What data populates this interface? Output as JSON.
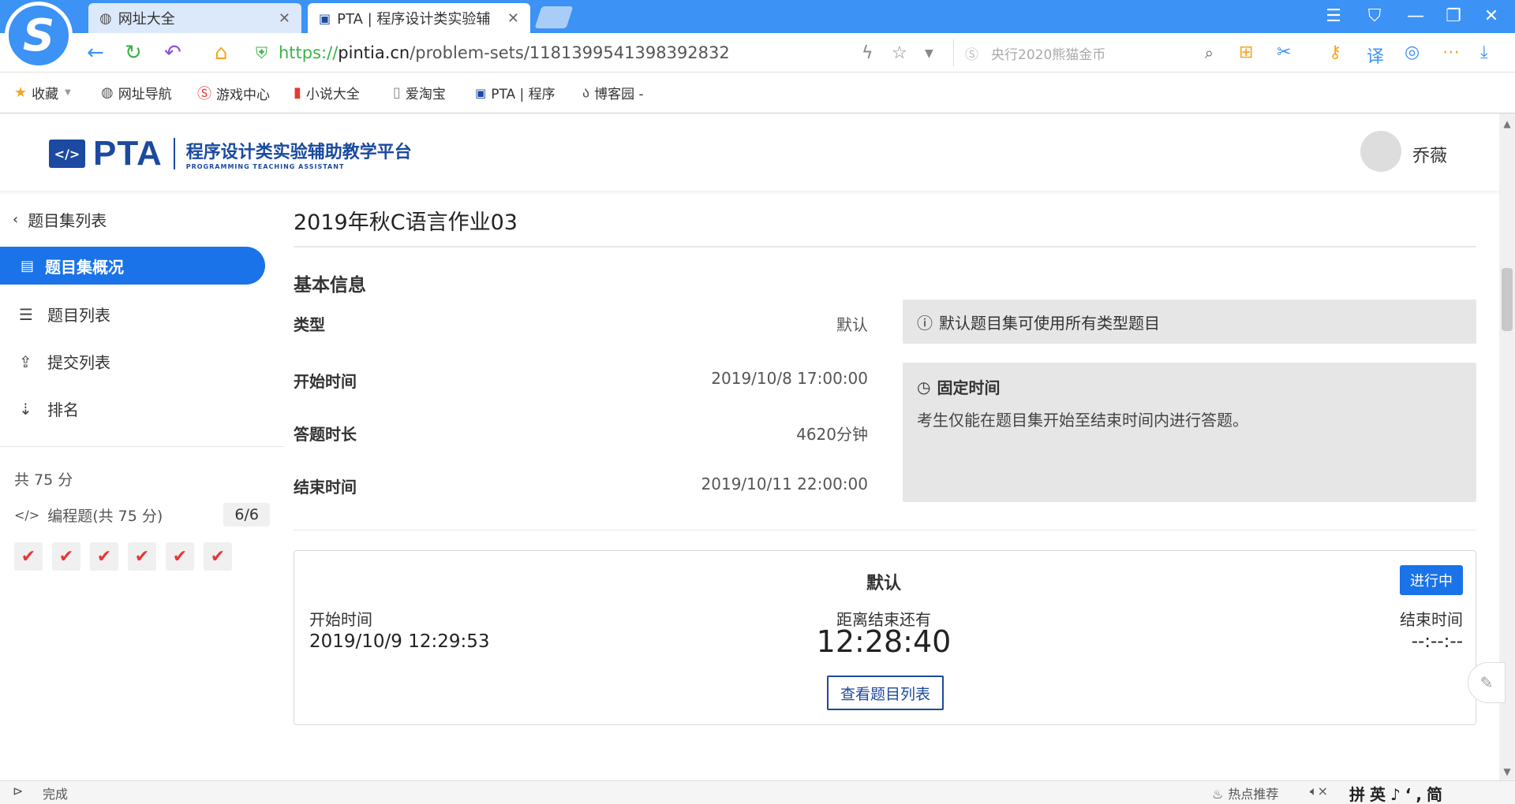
{
  "browser": {
    "tabs": [
      {
        "label": "网址大全",
        "active": false
      },
      {
        "label": "PTA | 程序设计类实验辅",
        "active": true
      }
    ],
    "url_scheme": "https://",
    "url_host": "pintia.cn",
    "url_path": "/problem-sets/1181399541398392832",
    "search_placeholder": "央行2020熊猫金币",
    "bookmarks": [
      {
        "label": "收藏",
        "icon": "star-icon"
      },
      {
        "label": "网址导航",
        "icon": "globe-icon"
      },
      {
        "label": "游戏中心",
        "icon": "game-icon"
      },
      {
        "label": "小说大全",
        "icon": "book-icon"
      },
      {
        "label": "爱淘宝",
        "icon": "page-icon"
      },
      {
        "label": "PTA | 程序",
        "icon": "pta-icon"
      },
      {
        "label": "博客园 -",
        "icon": "blog-icon"
      }
    ],
    "status_text": "完成",
    "hot_text": "热点推荐",
    "ime_text": "拼英♪‘,简"
  },
  "header": {
    "logo_badge": "</>",
    "logo_text": "PTA",
    "logo_cn": "程序设计类实验辅助教学平台",
    "logo_en": "PROGRAMMING TEACHING ASSISTANT",
    "username": "乔薇"
  },
  "sidebar": {
    "back_label": "题目集列表",
    "items": [
      {
        "label": "题目集概况",
        "icon": "book-icon",
        "active": true
      },
      {
        "label": "题目列表",
        "icon": "list-icon",
        "active": false
      },
      {
        "label": "提交列表",
        "icon": "upload-icon",
        "active": false
      },
      {
        "label": "排名",
        "icon": "sort-icon",
        "active": false
      }
    ],
    "total_score": "共 75 分",
    "programming_label": "编程题(共 75 分)",
    "programming_count": "6/6",
    "checks": [
      "✔",
      "✔",
      "✔",
      "✔",
      "✔",
      "✔"
    ]
  },
  "main": {
    "title": "2019年秋C语言作业03",
    "section_title": "基本信息",
    "info_rows": [
      {
        "label": "类型",
        "value": "默认"
      },
      {
        "label": "开始时间",
        "value": "2019/10/8 17:00:00"
      },
      {
        "label": "答题时长",
        "value": "4620分钟"
      },
      {
        "label": "结束时间",
        "value": "2019/10/11 22:00:00"
      }
    ],
    "type_note": "默认题目集可使用所有类型题目",
    "fixed_title": "固定时间",
    "fixed_desc": "考生仅能在题目集开始至结束时间内进行答题。",
    "card": {
      "title": "默认",
      "status": "进行中",
      "start_label": "开始时间",
      "start_value": "2019/10/9 12:29:53",
      "remain_label": "距离结束还有",
      "remain_value": "12:28:40",
      "end_label": "结束时间",
      "end_value": "--:--:--",
      "button": "查看题目列表"
    }
  }
}
